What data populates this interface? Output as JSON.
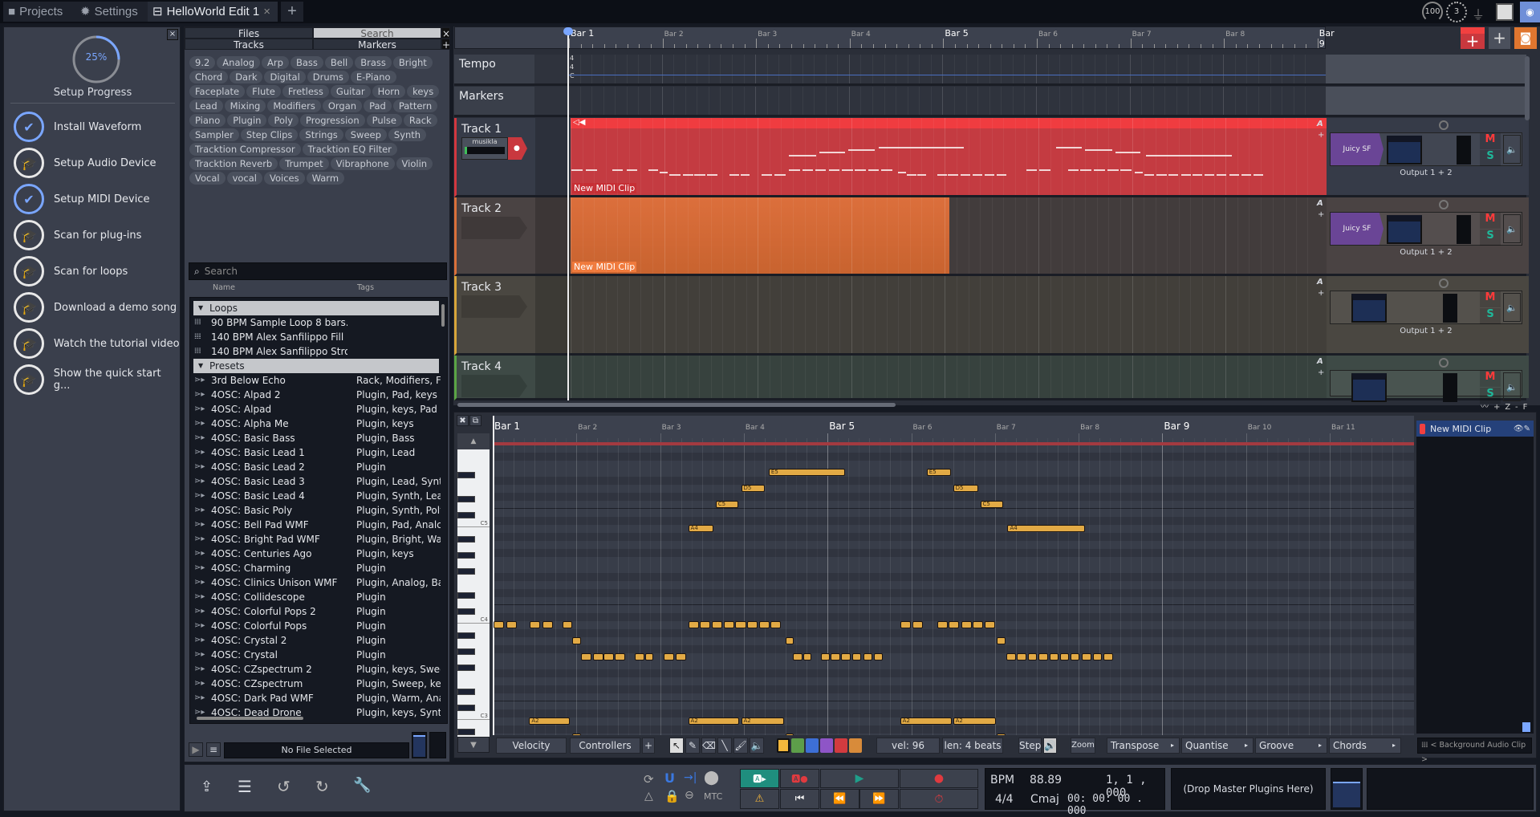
{
  "tabs": [
    {
      "label": "Projects",
      "icon": "folder-icon"
    },
    {
      "label": "Settings",
      "icon": "gear-icon"
    },
    {
      "label": "HelloWorld Edit 1",
      "icon": "edit-icon",
      "active": true
    }
  ],
  "status": {
    "cpu": "100",
    "midi": "3"
  },
  "setup": {
    "progress_percent": 25,
    "progress_label": "25%",
    "title": "Setup Progress",
    "items": [
      {
        "label": "Install Waveform",
        "done": true
      },
      {
        "label": "Setup Audio Device",
        "done": false
      },
      {
        "label": "Setup MIDI Device",
        "done": true
      },
      {
        "label": "Scan for plug-ins",
        "done": false
      },
      {
        "label": "Scan for loops",
        "done": false
      },
      {
        "label": "Download a demo song",
        "done": false
      },
      {
        "label": "Watch the tutorial video",
        "done": false
      },
      {
        "label": "Show the quick start g...",
        "done": false
      }
    ]
  },
  "browser": {
    "tabs": [
      "Files",
      "Search",
      "Tracks",
      "Markers"
    ],
    "active_tab": "Search",
    "tags": [
      "9.2",
      "Analog",
      "Arp",
      "Bass",
      "Bell",
      "Brass",
      "Bright",
      "Chord",
      "Dark",
      "Digital",
      "Drums",
      "E-Piano",
      "Faceplate",
      "Flute",
      "Fretless",
      "Guitar",
      "Horn",
      "keys",
      "Lead",
      "Mixing",
      "Modifiers",
      "Organ",
      "Pad",
      "Pattern",
      "Piano",
      "Plugin",
      "Poly",
      "Progression",
      "Pulse",
      "Rack",
      "Sampler",
      "Step Clips",
      "Strings",
      "Sweep",
      "Synth",
      "Tracktion Compressor",
      "Tracktion EQ Filter",
      "Tracktion Reverb",
      "Trumpet",
      "Vibraphone",
      "Violin",
      "Vocal",
      "vocal",
      "Voices",
      "Warm"
    ],
    "search_placeholder": "Search",
    "col_name": "Name",
    "col_tags": "Tags",
    "sections": [
      {
        "title": "Loops",
        "items": [
          {
            "name": "90 BPM Sample Loop 8 bars....",
            "tags": ""
          },
          {
            "name": "140 BPM Alex Sanfilippo Fill ...",
            "tags": ""
          },
          {
            "name": "140 BPM Alex Sanfilippo Stro...",
            "tags": ""
          }
        ]
      },
      {
        "title": "Presets",
        "items": [
          {
            "name": "3rd Below Echo",
            "tags": "Rack, Modifiers, F"
          },
          {
            "name": "4OSC: Alpad 2",
            "tags": "Plugin, Pad, keys"
          },
          {
            "name": "4OSC: Alpad",
            "tags": "Plugin, keys, Pad"
          },
          {
            "name": "4OSC: Alpha Me",
            "tags": "Plugin, keys"
          },
          {
            "name": "4OSC: Basic Bass",
            "tags": "Plugin, Bass"
          },
          {
            "name": "4OSC: Basic Lead 1",
            "tags": "Plugin, Lead"
          },
          {
            "name": "4OSC: Basic Lead 2",
            "tags": "Plugin"
          },
          {
            "name": "4OSC: Basic Lead 3",
            "tags": "Plugin, Lead, Synt"
          },
          {
            "name": "4OSC: Basic Lead 4",
            "tags": "Plugin, Synth, Lea"
          },
          {
            "name": "4OSC: Basic Poly",
            "tags": "Plugin, Synth, Poly"
          },
          {
            "name": "4OSC: Bell Pad WMF",
            "tags": "Plugin, Pad, Analc"
          },
          {
            "name": "4OSC: Bright Pad WMF",
            "tags": "Plugin, Bright, Wa"
          },
          {
            "name": "4OSC: Centuries Ago",
            "tags": "Plugin, keys"
          },
          {
            "name": "4OSC: Charming",
            "tags": "Plugin"
          },
          {
            "name": "4OSC: Clinics Unison WMF",
            "tags": "Plugin, Analog, Ba"
          },
          {
            "name": "4OSC: Collidescope",
            "tags": "Plugin"
          },
          {
            "name": "4OSC: Colorful Pops 2",
            "tags": "Plugin"
          },
          {
            "name": "4OSC: Colorful Pops",
            "tags": "Plugin"
          },
          {
            "name": "4OSC: Crystal 2",
            "tags": "Plugin"
          },
          {
            "name": "4OSC: Crystal",
            "tags": "Plugin"
          },
          {
            "name": "4OSC: CZspectrum 2",
            "tags": "Plugin, keys, Swee"
          },
          {
            "name": "4OSC: CZspectrum",
            "tags": "Plugin, Sweep, key"
          },
          {
            "name": "4OSC: Dark Pad WMF",
            "tags": "Plugin, Warm, Ana"
          },
          {
            "name": "4OSC: Dead Drone",
            "tags": "Plugin, keys, Synth"
          }
        ]
      }
    ],
    "file_status": "No File Selected"
  },
  "arrange": {
    "bars": [
      "Bar 1",
      "Bar 2",
      "Bar 3",
      "Bar 4",
      "Bar 5",
      "Bar 6",
      "Bar 7",
      "Bar 8",
      "Bar 9"
    ],
    "tempo_label": "Tempo",
    "tempo_values": [
      "4",
      "4",
      "C"
    ],
    "markers_label": "Markers",
    "tracks": [
      {
        "name": "Track 1",
        "color": "#d2373f",
        "bg": "#363b48",
        "input": "musikla",
        "clip": "New MIDI Clip",
        "clip_end_bar": 9.1,
        "plugin": "Juicy SF Wrapper",
        "output": "Output 1 + 2"
      },
      {
        "name": "Track 2",
        "color": "#d9703a",
        "bg": "#4a4343",
        "clip": "New MIDI Clip",
        "clip_end_bar": 5.05,
        "plugin": "Juicy SF Wrapper",
        "output": "Output 1 + 2"
      },
      {
        "name": "Track 3",
        "color": "#d8a63a",
        "bg": "#4a4741",
        "output": "Output 1 + 2"
      },
      {
        "name": "Track 4",
        "color": "#5aa545",
        "bg": "#3e4a46"
      }
    ],
    "mute": "M",
    "solo": "S",
    "auto": "A"
  },
  "piano_roll": {
    "bars": [
      "Bar 1",
      "Bar 2",
      "Bar 3",
      "Bar 4",
      "Bar 5",
      "Bar 6",
      "Bar 7",
      "Bar 8",
      "Bar 9",
      "Bar 10",
      "Bar 11"
    ],
    "key_labels": [
      "C5",
      "C4",
      "C3"
    ],
    "notes": [
      [
        "A4",
        9.34,
        1.2
      ],
      [
        "C5",
        10.65,
        1.1
      ],
      [
        "D5",
        11.87,
        1.15
      ],
      [
        "E5",
        13.19,
        3.65
      ],
      [
        "E5",
        20.74,
        1.15
      ],
      [
        "D5",
        22.0,
        1.2
      ],
      [
        "C5",
        23.3,
        1.1
      ],
      [
        "A4",
        24.6,
        3.7
      ],
      [
        "A3",
        0.05,
        0.5
      ],
      [
        "A3",
        0.66,
        0.5
      ],
      [
        "A3",
        1.78,
        0.5
      ],
      [
        "A3",
        2.39,
        0.5
      ],
      [
        "A3",
        3.33,
        0.45
      ],
      [
        "G3",
        3.8,
        0.4
      ],
      [
        "F3",
        4.22,
        0.5
      ],
      [
        "F3",
        4.79,
        0.5
      ],
      [
        "F3",
        5.3,
        0.5
      ],
      [
        "F3",
        5.82,
        0.5
      ],
      [
        "F3",
        6.8,
        0.45
      ],
      [
        "F3",
        7.27,
        0.4
      ],
      [
        "F3",
        8.16,
        0.5
      ],
      [
        "F3",
        8.73,
        0.5
      ],
      [
        "A3",
        9.34,
        0.5
      ],
      [
        "A3",
        9.9,
        0.5
      ],
      [
        "A3",
        10.46,
        0.5
      ],
      [
        "A3",
        11.03,
        0.5
      ],
      [
        "A3",
        11.6,
        0.5
      ],
      [
        "A3",
        12.15,
        0.5
      ],
      [
        "A3",
        12.72,
        0.5
      ],
      [
        "A3",
        13.28,
        0.5
      ],
      [
        "G3",
        13.98,
        0.4
      ],
      [
        "F3",
        14.36,
        0.45
      ],
      [
        "F3",
        14.83,
        0.4
      ],
      [
        "F3",
        15.67,
        0.45
      ],
      [
        "F3",
        16.14,
        0.45
      ],
      [
        "F3",
        16.66,
        0.45
      ],
      [
        "F3",
        17.17,
        0.45
      ],
      [
        "F3",
        17.7,
        0.45
      ],
      [
        "F3",
        18.2,
        0.45
      ],
      [
        "A3",
        19.47,
        0.5
      ],
      [
        "A3",
        20.04,
        0.5
      ],
      [
        "A3",
        21.26,
        0.5
      ],
      [
        "A3",
        21.8,
        0.5
      ],
      [
        "A3",
        22.38,
        0.5
      ],
      [
        "A3",
        22.95,
        0.5
      ],
      [
        "A3",
        23.5,
        0.5
      ],
      [
        "G3",
        24.1,
        0.4
      ],
      [
        "F3",
        24.54,
        0.45
      ],
      [
        "F3",
        25.06,
        0.45
      ],
      [
        "F3",
        25.57,
        0.45
      ],
      [
        "F3",
        26.09,
        0.45
      ],
      [
        "F3",
        26.6,
        0.45
      ],
      [
        "F3",
        27.1,
        0.45
      ],
      [
        "F3",
        27.6,
        0.45
      ],
      [
        "F3",
        28.15,
        0.45
      ],
      [
        "F3",
        28.67,
        0.45
      ],
      [
        "F3",
        29.2,
        0.45
      ],
      [
        "A2",
        1.74,
        1.95
      ],
      [
        "A2",
        9.34,
        2.45
      ],
      [
        "A2",
        11.87,
        2.05
      ],
      [
        "A2",
        19.47,
        2.45
      ],
      [
        "A2",
        22.0,
        2.05
      ],
      [
        "G2",
        3.8,
        0.4
      ],
      [
        "G2",
        14.0,
        0.4
      ],
      [
        "G2",
        24.1,
        0.4
      ],
      [
        "F2",
        4.22,
        2.45
      ],
      [
        "F2",
        6.8,
        2.4
      ],
      [
        "F2",
        14.36,
        2.45
      ],
      [
        "F2",
        16.94,
        2.4
      ],
      [
        "F2",
        24.54,
        2.45
      ],
      [
        "F2",
        27.1,
        4.7
      ]
    ],
    "clip_list_item": "New MIDI Clip",
    "background_clip": "< Background Audio Clip >",
    "toolbar": {
      "velocity": "Velocity",
      "controllers": "Controllers",
      "add": "+",
      "vel": "vel: 96",
      "len": "len: 4 beats",
      "step": "Step",
      "zoom": "Zoom",
      "transpose": "Transpose",
      "quantise": "Quantise",
      "groove": "Groove",
      "chords": "Chords"
    },
    "note_colors": [
      "#f3b73c",
      "#5d9e4a",
      "#3d6fd6",
      "#8e55c7",
      "#d23b3f",
      "#d88b3a"
    ]
  },
  "transport": {
    "bpm_label": "BPM",
    "bpm": "88.89",
    "time_sig": "4/4",
    "key": "Cmaj",
    "position": "1, 1 , 000",
    "time": "00: 00: 00 . 000",
    "mtc": "MTC",
    "master_drop": "(Drop Master Plugins Here)"
  },
  "colors": {
    "accent": "#7aa6ff",
    "record": "#e03a3f",
    "play": "#1f9e8a"
  }
}
